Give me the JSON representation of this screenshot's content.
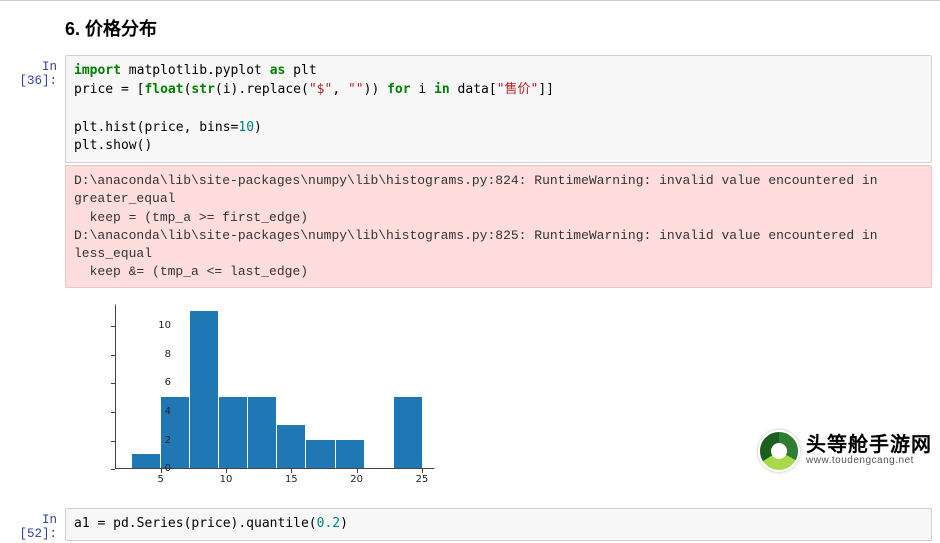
{
  "heading": "6. 价格分布",
  "cells": {
    "c1": {
      "prompt": "In [36]:",
      "code": {
        "l1_import": "import",
        "l1_mod": " matplotlib.pyplot ",
        "l1_as": "as",
        "l1_alias": " plt",
        "l2a": "price = [",
        "l2_float": "float",
        "l2b": "(",
        "l2_str": "str",
        "l2c": "(i).replace(",
        "l2_s1": "\"$\"",
        "l2d": ", ",
        "l2_s2": "\"\"",
        "l2e": ")) ",
        "l2_for": "for",
        "l2f": " i ",
        "l2_in": "in",
        "l2g": " data[",
        "l2_key": "\"售价\"",
        "l2h": "]]",
        "l4a": "plt.hist(price, bins=",
        "l4_n": "10",
        "l4b": ")",
        "l5": "plt.show()"
      },
      "warning": "D:\\anaconda\\lib\\site-packages\\numpy\\lib\\histograms.py:824: RuntimeWarning: invalid value encountered in greater_equal\n  keep = (tmp_a >= first_edge)\nD:\\anaconda\\lib\\site-packages\\numpy\\lib\\histograms.py:825: RuntimeWarning: invalid value encountered in less_equal\n  keep &= (tmp_a <= last_edge)"
    },
    "c2": {
      "prompt": "In [52]:",
      "code": {
        "l1a": "a1 = pd.Series(price).quantile(",
        "l1_n": "0.2",
        "l1b": ")"
      }
    }
  },
  "chart_data": {
    "type": "bar",
    "bin_edges": [
      2.7,
      4.93,
      7.16,
      9.39,
      11.62,
      13.85,
      16.08,
      18.31,
      20.54,
      22.77,
      25.0
    ],
    "values": [
      1,
      5,
      11,
      5,
      5,
      3,
      2,
      2,
      0,
      5
    ],
    "x_ticks": [
      5,
      10,
      15,
      20,
      25
    ],
    "y_ticks": [
      0,
      2,
      4,
      6,
      8,
      10
    ],
    "xlim": [
      1.5,
      26.0
    ],
    "ylim": [
      0,
      11.5
    ],
    "bar_color": "#1f77b4"
  },
  "watermark": {
    "cn": "头等舱手游网",
    "en": "www.toudengcang.net"
  }
}
